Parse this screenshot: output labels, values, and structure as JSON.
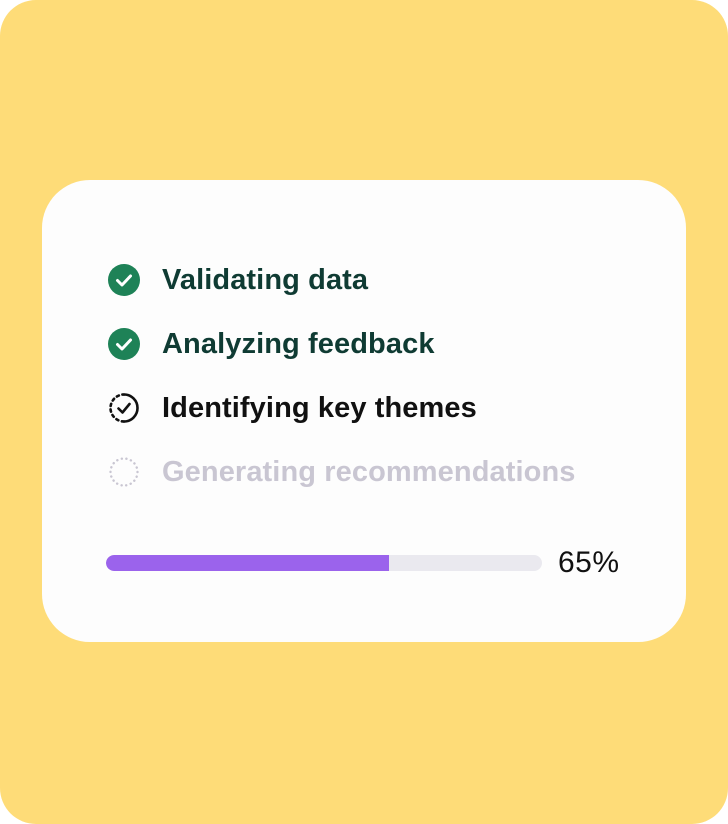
{
  "steps": [
    {
      "label": "Validating data",
      "status": "done",
      "icon": "check-circle-icon"
    },
    {
      "label": "Analyzing feedback",
      "status": "done",
      "icon": "check-circle-icon"
    },
    {
      "label": "Identifying key themes",
      "status": "active",
      "icon": "dashed-check-circle-icon"
    },
    {
      "label": "Generating recommendations",
      "status": "pending",
      "icon": "dotted-circle-icon"
    }
  ],
  "progress": {
    "value": 0.65,
    "label": "65%"
  },
  "colors": {
    "background": "#FEDC78",
    "card": "#FDFDFD",
    "done_icon": "#1E8257",
    "done_text": "#0F3B33",
    "active_text": "#111111",
    "pending_text": "#C9C6D2",
    "progress_fill": "#9B63EC",
    "progress_track": "#EAE9EF"
  }
}
